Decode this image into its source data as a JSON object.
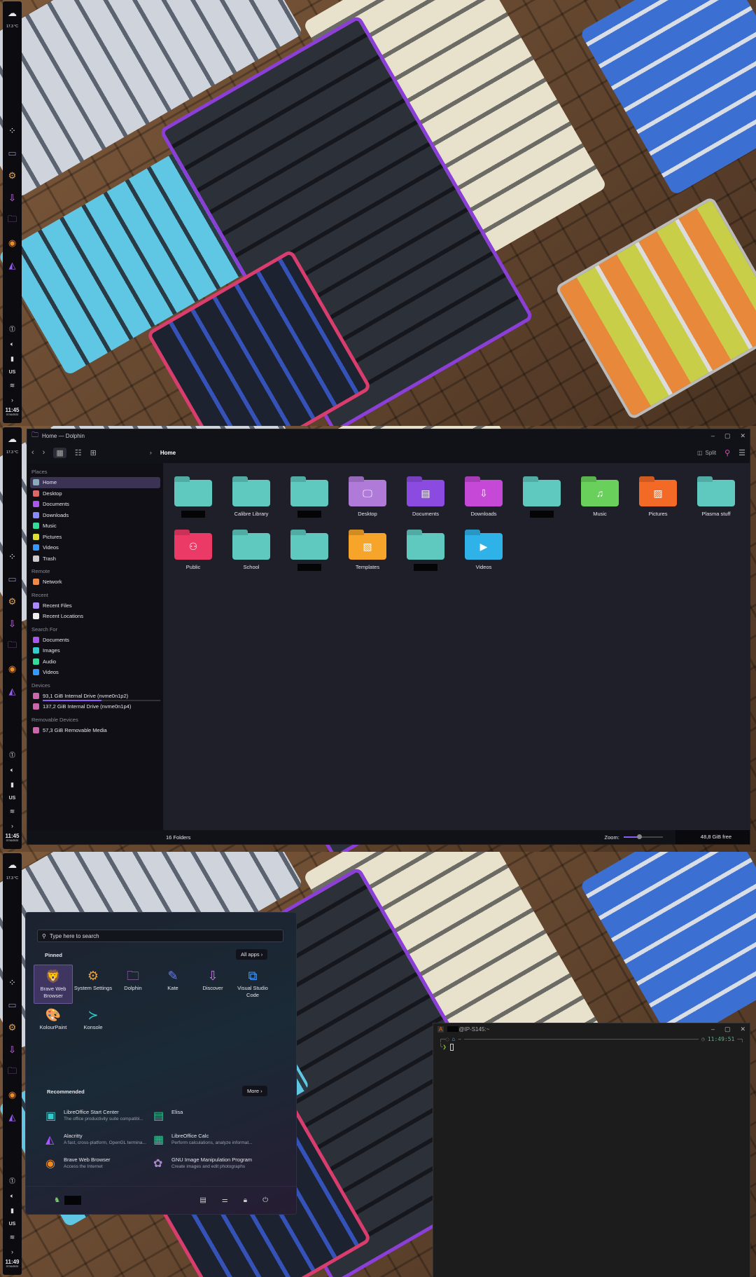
{
  "taskbar": {
    "temperature": "17.3 °C",
    "layout": "US",
    "chevron": "›",
    "time1": "11:45",
    "time2": "11:45",
    "time3": "11:49",
    "date": "07/16/2023",
    "apps": [
      "overview-icon",
      "virtual-desktops-icon",
      "settings-icon",
      "discover-icon",
      "dolphin-icon",
      "brave-icon",
      "alacritty-icon"
    ]
  },
  "dolphin": {
    "title": "Home — Dolphin",
    "breadcrumb": "Home",
    "split_label": "Split",
    "places_header": "Places",
    "places": [
      "Home",
      "Desktop",
      "Documents",
      "Downloads",
      "Music",
      "Pictures",
      "Videos",
      "Trash"
    ],
    "remote_header": "Remote",
    "remote": [
      "Network"
    ],
    "recent_header": "Recent",
    "recent": [
      "Recent Files",
      "Recent Locations"
    ],
    "search_header": "Search For",
    "search": [
      "Documents",
      "Images",
      "Audio",
      "Videos"
    ],
    "devices_header": "Devices",
    "devices": [
      "93,1 GiB Internal Drive (nvme0n1p2)",
      "137,2 GiB Internal Drive (nvme0n1p4)"
    ],
    "device_usage_fraction": 0.5,
    "removable_header": "Removable Devices",
    "removable": [
      "57,3 GiB Removable Media"
    ],
    "folders": [
      {
        "label": "",
        "color": "#5fc9c0"
      },
      {
        "label": "Calibre Library",
        "color": "#5fc9c0"
      },
      {
        "label": "",
        "color": "#5fc9c0"
      },
      {
        "label": "Desktop",
        "color": "#b07ad8"
      },
      {
        "label": "Documents",
        "color": "#8c4be0"
      },
      {
        "label": "Downloads",
        "color": "#c548d6"
      },
      {
        "label": "",
        "color": "#5fc9c0"
      },
      {
        "label": "Music",
        "color": "#6ad05c"
      },
      {
        "label": "Pictures",
        "color": "#f26a25"
      },
      {
        "label": "Plasma stuff",
        "color": "#5fc9c0"
      },
      {
        "label": "Public",
        "color": "#ec3a66"
      },
      {
        "label": "School",
        "color": "#5fc9c0"
      },
      {
        "label": "",
        "color": "#5fc9c0"
      },
      {
        "label": "Templates",
        "color": "#f7a52a"
      },
      {
        "label": "",
        "color": "#5fc9c0"
      },
      {
        "label": "Videos",
        "color": "#2fb2e8"
      }
    ],
    "status_count": "16 Folders",
    "zoom_label": "Zoom:",
    "zoom_fraction": 0.4,
    "free_space": "48,8 GiB free"
  },
  "start_menu": {
    "search_placeholder": "Type here to search",
    "pinned_header": "Pinned",
    "all_apps": "All apps ›",
    "pinned": [
      {
        "label": "Brave Web Browser",
        "icon": "🦁"
      },
      {
        "label": "System Settings",
        "icon": "⚙"
      },
      {
        "label": "Dolphin",
        "icon": "🗀"
      },
      {
        "label": "Kate",
        "icon": "✎"
      },
      {
        "label": "Discover",
        "icon": "⇩"
      },
      {
        "label": "Visual Studio Code",
        "icon": "⧉"
      },
      {
        "label": "KolourPaint",
        "icon": "🎨"
      },
      {
        "label": "Konsole",
        "icon": "≻"
      }
    ],
    "recommended_header": "Recommended",
    "more": "More ›",
    "recommended": [
      {
        "title": "LibreOffice Start Center",
        "desc": "The office productivity suite compatibl...",
        "icon": "▣"
      },
      {
        "title": "Elisa",
        "desc": "",
        "icon": "▤"
      },
      {
        "title": "Alacritty",
        "desc": "A fast, cross-platform, OpenGL termina...",
        "icon": "◭"
      },
      {
        "title": "LibreOffice Calc",
        "desc": "Perform calculations, analyze informat...",
        "icon": "▦"
      },
      {
        "title": "Brave Web Browser",
        "desc": "Access the Internet",
        "icon": "◉"
      },
      {
        "title": "GNU Image Manipulation Program",
        "desc": "Create images and edit photographs",
        "icon": "✿"
      }
    ]
  },
  "terminal": {
    "title": "@IP-S145:~",
    "prompt_path": "~",
    "clock": "11:49:51",
    "prompt_symbol": "❯"
  },
  "colors": {
    "accent": "#8b5cf6",
    "content_bg": "#1e1f29"
  }
}
